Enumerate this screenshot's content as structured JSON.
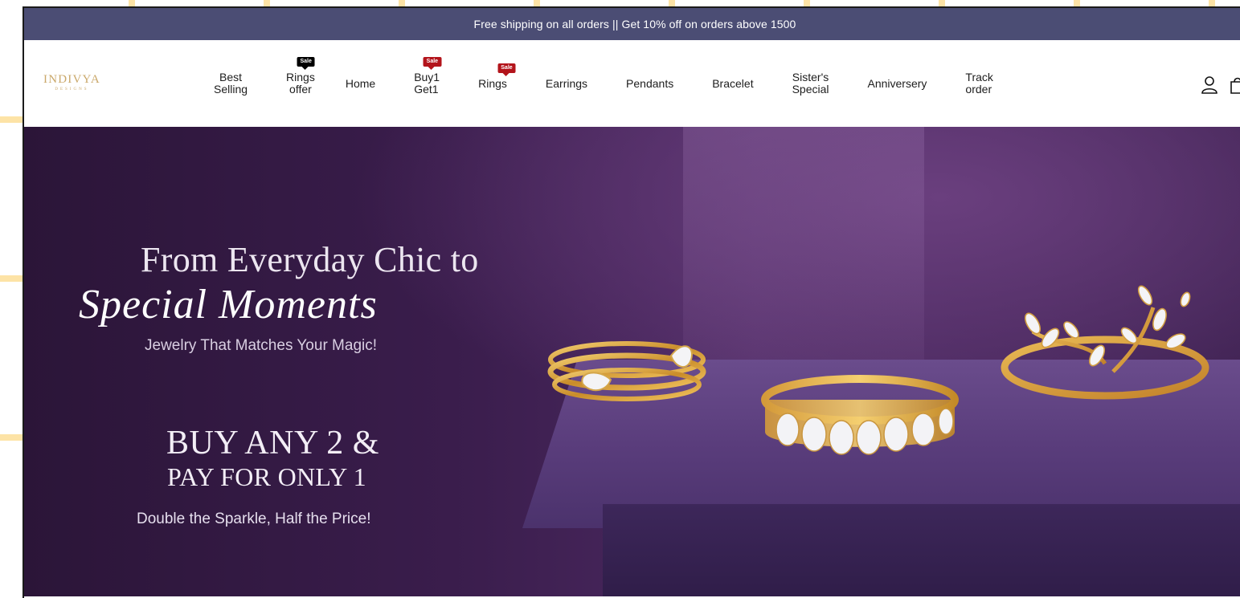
{
  "announcement": "Free shipping on all orders || Get 10% off on orders above 1500",
  "logo": {
    "name": "INDIVYA",
    "sub": "DESIGNS"
  },
  "nav": [
    {
      "label_line1": "Best",
      "label_line2": "Selling",
      "badge": ""
    },
    {
      "label_line1": "Rings",
      "label_line2": "offer",
      "badge": "Sale"
    },
    {
      "label_line1": "Home",
      "label_line2": "",
      "badge": ""
    },
    {
      "label_line1": "Buy1",
      "label_line2": "Get1",
      "badge": "Sale"
    },
    {
      "label_line1": "Rings",
      "label_line2": "",
      "badge": "Sale"
    },
    {
      "label_line1": "Earrings",
      "label_line2": "",
      "badge": ""
    },
    {
      "label_line1": "Pendants",
      "label_line2": "",
      "badge": ""
    },
    {
      "label_line1": "Bracelet",
      "label_line2": "",
      "badge": ""
    },
    {
      "label_line1": "Sister's",
      "label_line2": "Special",
      "badge": ""
    },
    {
      "label_line1": "Anniversery",
      "label_line2": "",
      "badge": ""
    },
    {
      "label_line1": "Track",
      "label_line2": "order",
      "badge": ""
    }
  ],
  "icons": [
    "account-icon",
    "cart-icon"
  ],
  "hero": {
    "line1": "From Everyday Chic to",
    "line2": "Special Moments",
    "line3": "Jewelry That Matches Your Magic!",
    "offer_line1": "BUY ANY 2 &",
    "offer_line2": "PAY FOR ONLY 1",
    "offer_line3": "Double the Sparkle, Half the Price!"
  },
  "colors": {
    "announcement_bg": "#4b4d74",
    "hero_bg": "#3a1d4c",
    "gold": "#d9a441",
    "sale_black": "#000000",
    "sale_red": "#b3141b"
  }
}
